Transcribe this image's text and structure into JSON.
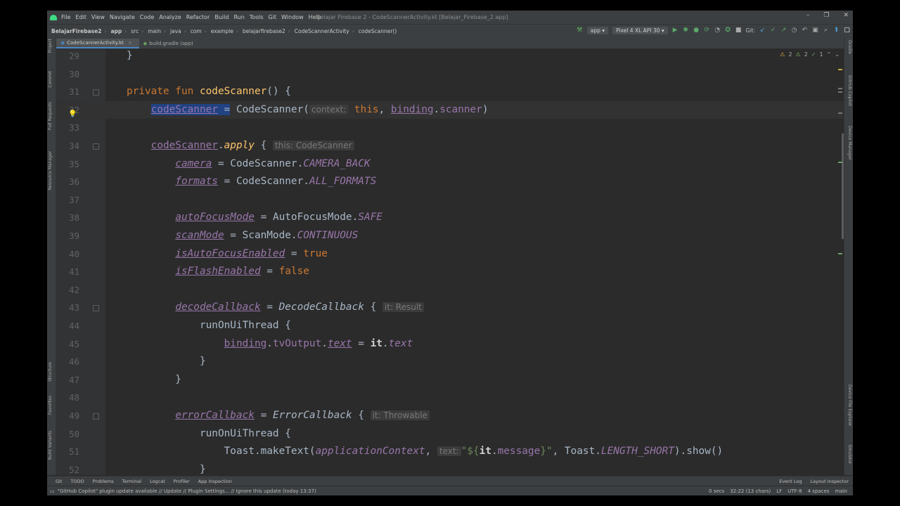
{
  "menu": {
    "items": [
      "File",
      "Edit",
      "View",
      "Navigate",
      "Code",
      "Analyze",
      "Refactor",
      "Build",
      "Run",
      "Tools",
      "Git",
      "Window",
      "Help"
    ],
    "title": "Belajar Firebase 2 - CodeScannerActivity.kt [Belajar_Firebase_2.app]"
  },
  "breadcrumb": [
    "BelajarFirebase2",
    "app",
    "src",
    "main",
    "java",
    "com",
    "example",
    "belajarfirebase2",
    "CodeScannerActivity",
    "codeScanner()"
  ],
  "toolbar": {
    "config": "app",
    "device": "Pixel 4 XL API 30",
    "git_label": "Git:"
  },
  "tabs": [
    "CodeScannerActivity.kt",
    "build.gradle (app)"
  ],
  "left_tools": [
    "Project",
    "Commit",
    "Pull Requests",
    "Resource Manager",
    "Structure",
    "Favorites",
    "Build Variants"
  ],
  "right_tools": [
    "Gradle",
    "GitHub Copilot",
    "Device Manager",
    "Device File Explorer",
    "Emulator"
  ],
  "inspection": {
    "warnings": "2",
    "weak": "2",
    "typos": "1"
  },
  "editor": {
    "lines": [
      {
        "n": "29"
      },
      {
        "n": "30"
      },
      {
        "n": "31"
      },
      {
        "n": "32"
      },
      {
        "n": "33"
      },
      {
        "n": "34"
      },
      {
        "n": "35"
      },
      {
        "n": "36"
      },
      {
        "n": "37"
      },
      {
        "n": "38"
      },
      {
        "n": "39"
      },
      {
        "n": "40"
      },
      {
        "n": "41"
      },
      {
        "n": "42"
      },
      {
        "n": "43"
      },
      {
        "n": "44"
      },
      {
        "n": "45"
      },
      {
        "n": "46"
      },
      {
        "n": "47"
      },
      {
        "n": "48"
      },
      {
        "n": "49"
      },
      {
        "n": "50"
      },
      {
        "n": "51"
      },
      {
        "n": "52"
      }
    ]
  },
  "bottom_tools": [
    "Git",
    "TODO",
    "Problems",
    "Terminal",
    "Logcat",
    "Profiler",
    "App Inspection",
    "Event Log",
    "Layout Inspector"
  ],
  "status": {
    "message": "\"GitHub Copilot\" plugin update available // Update // Plugin Settings... // Ignore this update (today 13:37)",
    "time": "0 secs",
    "position": "32:22 (13 chars)",
    "line_sep": "LF",
    "encoding": "UTF-8",
    "indent": "4 spaces",
    "branch": "main"
  }
}
